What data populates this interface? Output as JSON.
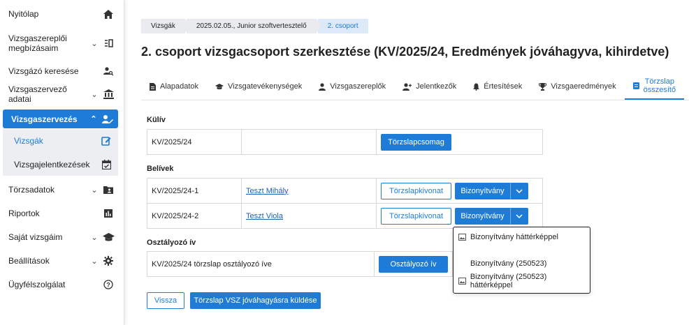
{
  "sidebar": {
    "items": [
      {
        "label": "Nyitólap",
        "icon": "home-icon"
      },
      {
        "label": "Vizsgaszereplői megbízásaim",
        "icon": "assignment-icon"
      },
      {
        "label": "Vizsgázó keresése",
        "icon": "person-search-icon"
      },
      {
        "label": "Vizsgaszervező adatai",
        "icon": "institution-icon"
      },
      {
        "label": "Vizsgaszervezés",
        "icon": "person-edit-icon"
      },
      {
        "label": "Törzsadatok",
        "icon": "folder-person-icon"
      },
      {
        "label": "Riportok",
        "icon": "bar-chart-icon"
      },
      {
        "label": "Saját vizsgáim",
        "icon": "graduation-cap-icon"
      },
      {
        "label": "Beállítások",
        "icon": "gear-icon"
      },
      {
        "label": "Ügyfélszolgálat",
        "icon": "help-icon"
      }
    ],
    "subitems": [
      {
        "label": "Vizsgák",
        "icon": "edit-icon"
      },
      {
        "label": "Vizsgajelentkezések",
        "icon": "calendar-check-icon"
      }
    ]
  },
  "breadcrumb": [
    "Vizsgák",
    "2025.02.05., Junior szoftvertesztelő",
    "2. csoport"
  ],
  "page_title": "2. csoport vizsgacsoport szerkesztése (KV/2025/24, Eredmények jóváhagyva, kihirdetve)",
  "tabs": [
    {
      "label": "Alapadatok",
      "icon": "document-icon"
    },
    {
      "label": "Vizsgatevékenységek",
      "icon": "school-icon"
    },
    {
      "label": "Vizsgaszereplők",
      "icon": "person-icon"
    },
    {
      "label": "Jelentkezők",
      "icon": "person-add-icon"
    },
    {
      "label": "Értesítések",
      "icon": "bell-icon"
    },
    {
      "label": "Vizsgaeredmények",
      "icon": "trophy-icon"
    },
    {
      "label_line1": "Törzslap",
      "label_line2": "összesítő",
      "icon": "list-icon"
    }
  ],
  "sections": {
    "kuliv": {
      "title": "Külív",
      "id": "KV/2025/24",
      "button": "Törzslapcsomag"
    },
    "beliv": {
      "title": "Belívek",
      "rows": [
        {
          "id": "KV/2025/24-1",
          "name": "Teszt Mihály",
          "kivonat": "Törzslapkivonat",
          "bizonyitvany": "Bizonyítvány"
        },
        {
          "id": "KV/2025/24-2",
          "name": "Teszt Viola",
          "kivonat": "Törzslapkivonat",
          "bizonyitvany": "Bizonyítvány"
        }
      ]
    },
    "osztalyozo": {
      "title": "Osztályozó ív",
      "text": "KV/2025/24 törzslap osztályozó íve",
      "button": "Osztályozó ív"
    }
  },
  "dropdown": {
    "items": [
      {
        "label": "Bizonyítvány háttérképpel",
        "icon": "image-icon"
      },
      {
        "label": "Bizonyítvány (250523)",
        "icon": ""
      },
      {
        "label": "Bizonyítvány (250523) háttérképpel",
        "icon": "image-icon"
      }
    ]
  },
  "footer": {
    "back": "Vissza",
    "send": "Törzslap VSZ jóváhagyásra küldése"
  },
  "colors": {
    "accent": "#1e7cd6",
    "link": "#1e5fb4"
  }
}
